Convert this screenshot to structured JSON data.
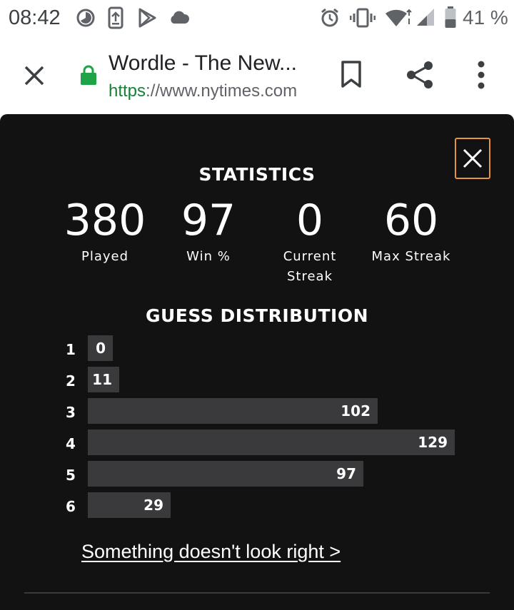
{
  "status_bar": {
    "time": "08:42",
    "battery_text": "41 %",
    "icons": [
      "data-saver-icon",
      "download-icon",
      "play-store-icon",
      "cloud-icon",
      "alarm-icon",
      "vibrate-icon",
      "wifi-icon",
      "signal-icon",
      "battery-icon"
    ]
  },
  "browser": {
    "page_title": "Wordle - The New...",
    "url_scheme": "https",
    "url_rest": "://www.nytimes.com",
    "icons": [
      "close-icon",
      "lock-icon",
      "bookmark-icon",
      "share-icon",
      "more-vert-icon"
    ],
    "lock_color": "#1ea446"
  },
  "modal": {
    "close_icon": "close-icon",
    "close_border_color": "#e6963c",
    "statistics_heading": "STATISTICS",
    "stats": [
      {
        "value": "380",
        "label": "Played"
      },
      {
        "value": "97",
        "label": "Win %"
      },
      {
        "value": "0",
        "label": "Current Streak"
      },
      {
        "value": "60",
        "label": "Max Streak"
      }
    ],
    "distribution_heading": "GUESS DISTRIBUTION",
    "report_link": "Something doesn't look right >"
  },
  "chart_data": {
    "type": "bar",
    "orientation": "horizontal",
    "title": "GUESS DISTRIBUTION",
    "categories": [
      "1",
      "2",
      "3",
      "4",
      "5",
      "6"
    ],
    "values": [
      0,
      11,
      102,
      129,
      97,
      29
    ],
    "bar_color": "#3a3a3c"
  }
}
